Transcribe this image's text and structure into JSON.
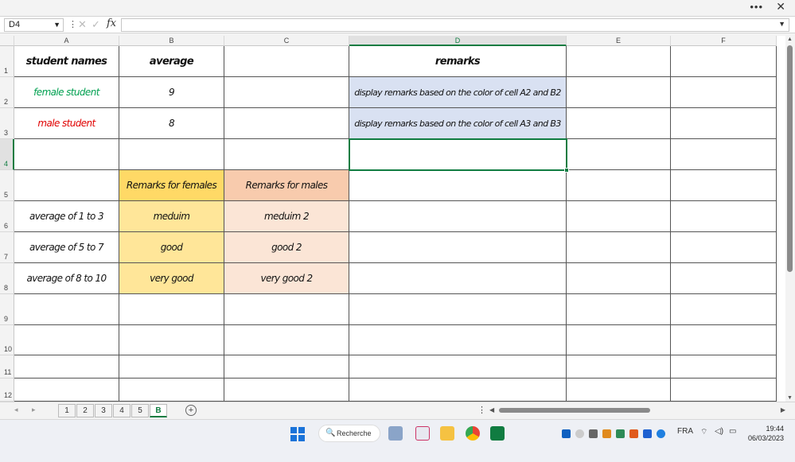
{
  "window": {
    "more_label": "•••",
    "close_label": "✕"
  },
  "formula_bar": {
    "name_box": "D4",
    "formula": "",
    "fx_label": "fx",
    "cancel_label": "✕",
    "enter_label": "✓",
    "separator": "⋮"
  },
  "columns": [
    "A",
    "B",
    "C",
    "D",
    "E",
    "F"
  ],
  "rows": [
    "1",
    "2",
    "3",
    "4",
    "5",
    "6",
    "7",
    "8",
    "9",
    "10",
    "11",
    "12"
  ],
  "cells": {
    "A1": "student names",
    "B1": "average",
    "D1": "remarks",
    "A2": "female student",
    "B2": "9",
    "D2": "display remarks based on the color of cell A2 and B2",
    "A3": "male student",
    "B3": "8",
    "D3": "display remarks based on the color of cell A3 and B3",
    "B5": "Remarks for females",
    "C5": "Remarks for males",
    "A6": "average of 1 to 3",
    "B6": "meduim",
    "C6": "meduim 2",
    "A7": "average of 5 to 7",
    "B7": "good",
    "C7": "good 2",
    "A8": "average of 8 to 10",
    "B8": "very good",
    "C8": "very good 2"
  },
  "sheet_tabs": [
    "1",
    "2",
    "3",
    "4",
    "5",
    "B"
  ],
  "active_sheet": "B",
  "sheet_nav": {
    "prev": "◂",
    "next": "▸",
    "add": "+",
    "more": "⋮"
  },
  "scroll_arrows": {
    "up": "▲",
    "down": "▼",
    "left": "◀",
    "right": "▶"
  },
  "taskbar": {
    "search_label": "Recherche",
    "search_icon": "🔍",
    "language": "FRA",
    "time": "19:44",
    "date": "06/03/2023"
  },
  "colors": {
    "accent": "#107c41",
    "female_text": "#00a050",
    "male_text": "#e00000",
    "remark_blue": "#d9e1f2",
    "female_header": "#ffd966",
    "female_light": "#ffe699",
    "male_header": "#f8cbad",
    "male_light": "#fbe5d6"
  },
  "icons": [
    "windows-icon",
    "search-icon",
    "calculator-icon",
    "snipping-tool-icon",
    "file-explorer-icon",
    "chrome-icon",
    "excel-icon"
  ]
}
